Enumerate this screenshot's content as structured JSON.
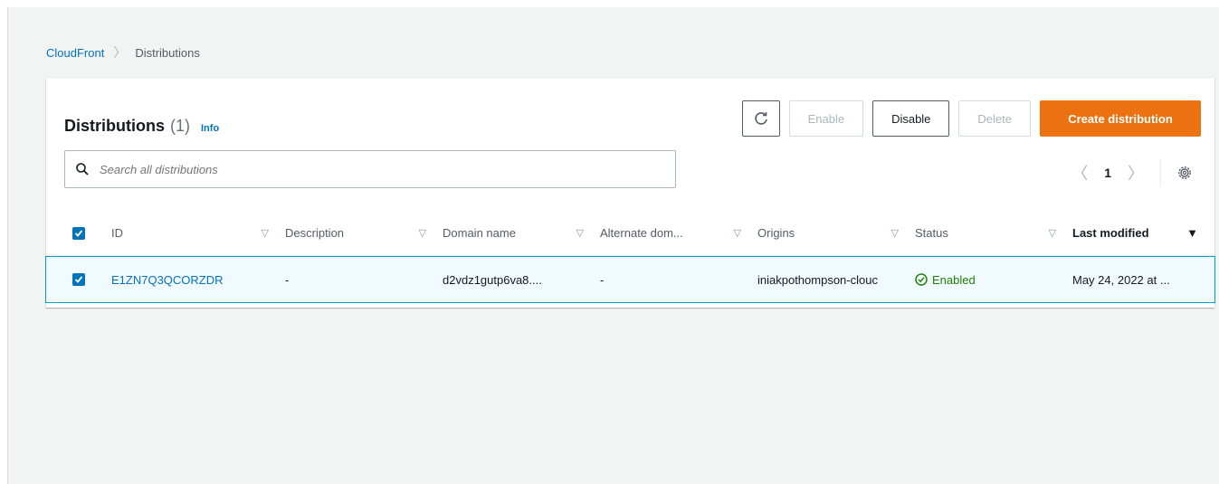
{
  "breadcrumb": {
    "root": "CloudFront",
    "separator": "〉",
    "current": "Distributions"
  },
  "panel": {
    "title": "Distributions",
    "count": "(1)",
    "info": "Info"
  },
  "toolbar": {
    "refresh_icon": "refresh-icon",
    "enable": "Enable",
    "disable": "Disable",
    "delete": "Delete",
    "create": "Create distribution"
  },
  "search": {
    "placeholder": "Search all distributions"
  },
  "pagination": {
    "prev": "〈",
    "page": "1",
    "next": "〉"
  },
  "table": {
    "headers": [
      "ID",
      "Description",
      "Domain name",
      "Alternate dom...",
      "Origins",
      "Status",
      "Last modified"
    ],
    "rows": [
      {
        "id": "E1ZN7Q3QCORZDR",
        "description": "-",
        "domain": "d2vdz1gutp6va8....",
        "alternate": "-",
        "origins": "iniakpothompson-clouc",
        "status": "Enabled",
        "last_modified": "May 24, 2022 at ..."
      }
    ]
  },
  "colors": {
    "accent": "#0073bb",
    "primary_button": "#ec7211",
    "success": "#1d8102",
    "selected_row_border": "#00a1c9"
  }
}
